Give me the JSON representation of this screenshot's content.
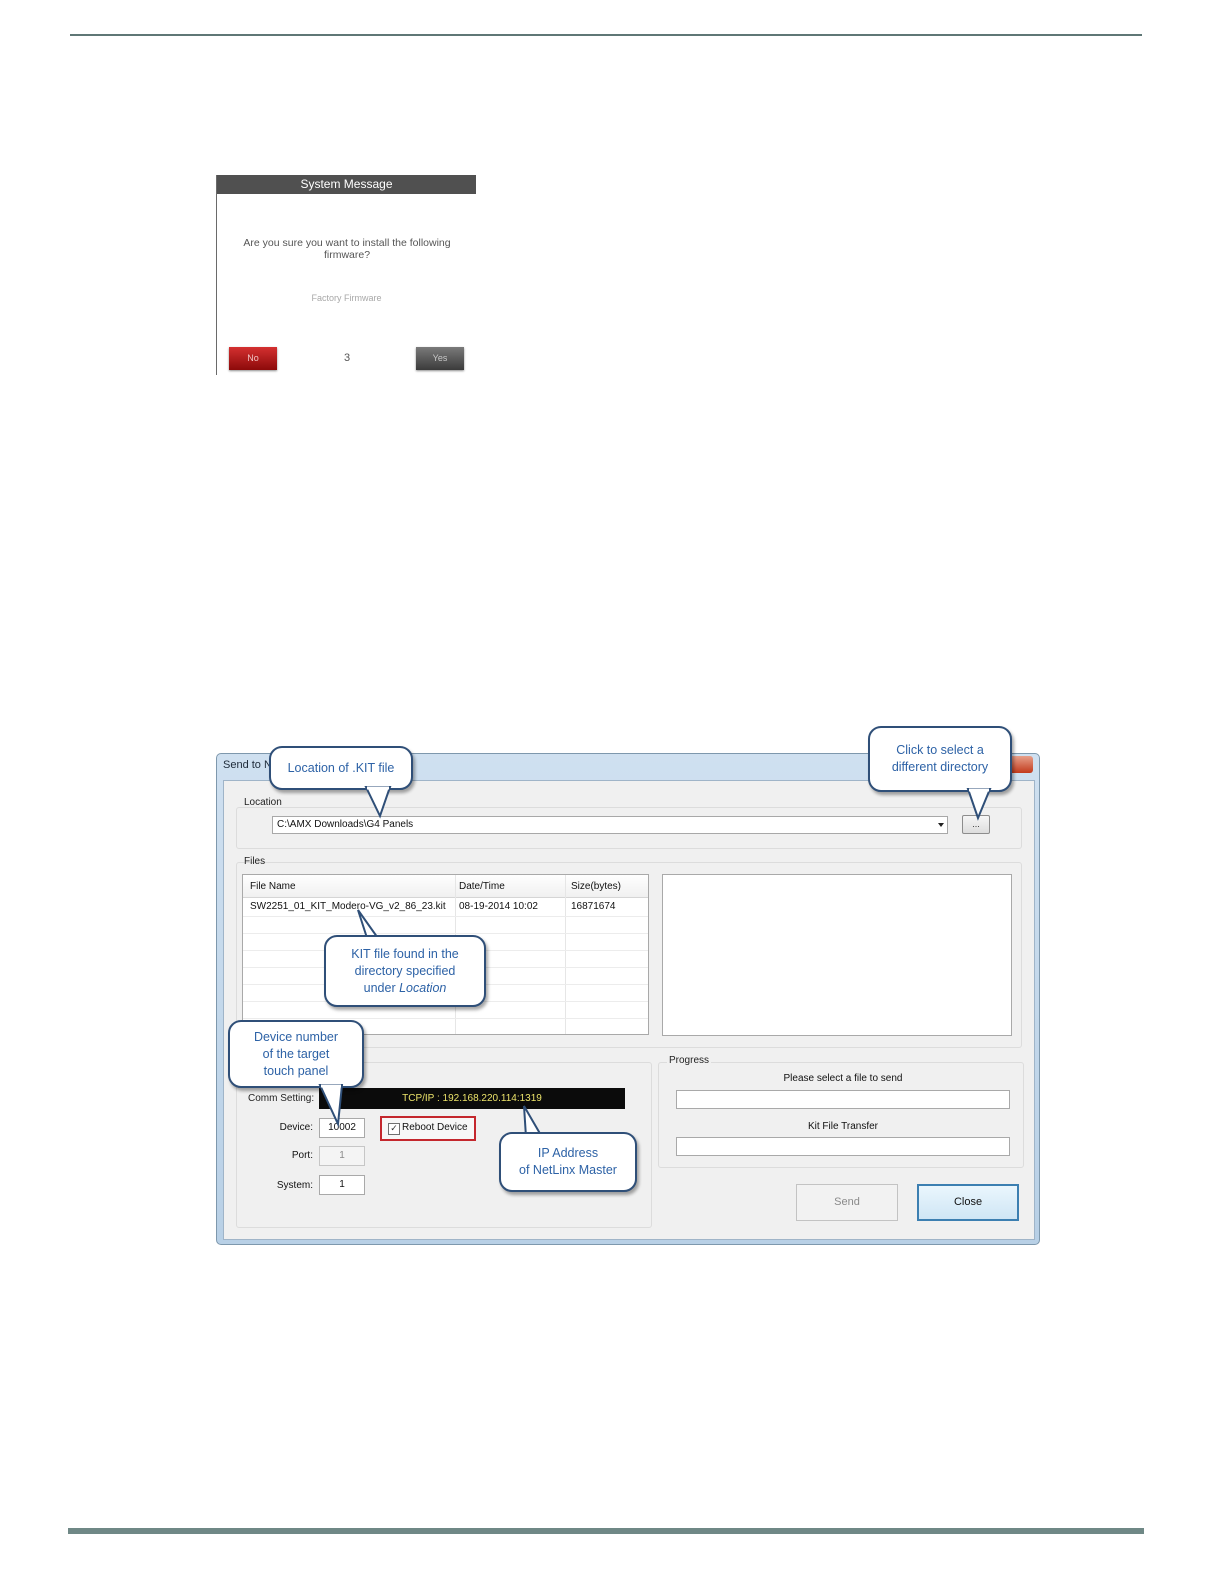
{
  "system_message": {
    "title": "System Message",
    "question": "Are you sure you want to install the following firmware?",
    "firmware": "Factory Firmware",
    "no_label": "No",
    "countdown": "3",
    "yes_label": "Yes"
  },
  "send_dialog": {
    "title": "Send to N",
    "location_label": "Location",
    "location_value": "C:\\AMX Downloads\\G4 Panels",
    "browse_label": "...",
    "files_label": "Files",
    "columns": [
      "File Name",
      "Date/Time",
      "Size(bytes)"
    ],
    "file_row": {
      "name": "SW2251_01_KIT_Modero-VG_v2_86_23.kit",
      "datetime": "08-19-2014  10:02",
      "size": "16871674"
    },
    "comm_label": "Comm Setting:",
    "comm_value": "TCP/IP : 192.168.220.114:1319",
    "device_label": "Device:",
    "device_value": "10002",
    "port_label": "Port:",
    "port_value": "1",
    "system_label": "System:",
    "system_value": "1",
    "reboot_label": "Reboot Device",
    "reboot_checked": "✓",
    "progress_label": "Progress",
    "progress_status": "Please select a file to send",
    "kit_transfer_label": "Kit File Transfer",
    "send_label": "Send",
    "close_label": "Close"
  },
  "callouts": {
    "location": "Location of .KIT file",
    "browse_line1": "Click to select a",
    "browse_line2": "different directory",
    "kit_line1": "KIT file found in the",
    "kit_line2": "directory specified",
    "kit_line3_prefix": "under ",
    "kit_line3_italic": "Location",
    "device_line1": "Device number",
    "device_line2": "of the target",
    "device_line3": "touch panel",
    "ip_line1": "IP Address",
    "ip_line2": "of NetLinx Master"
  }
}
